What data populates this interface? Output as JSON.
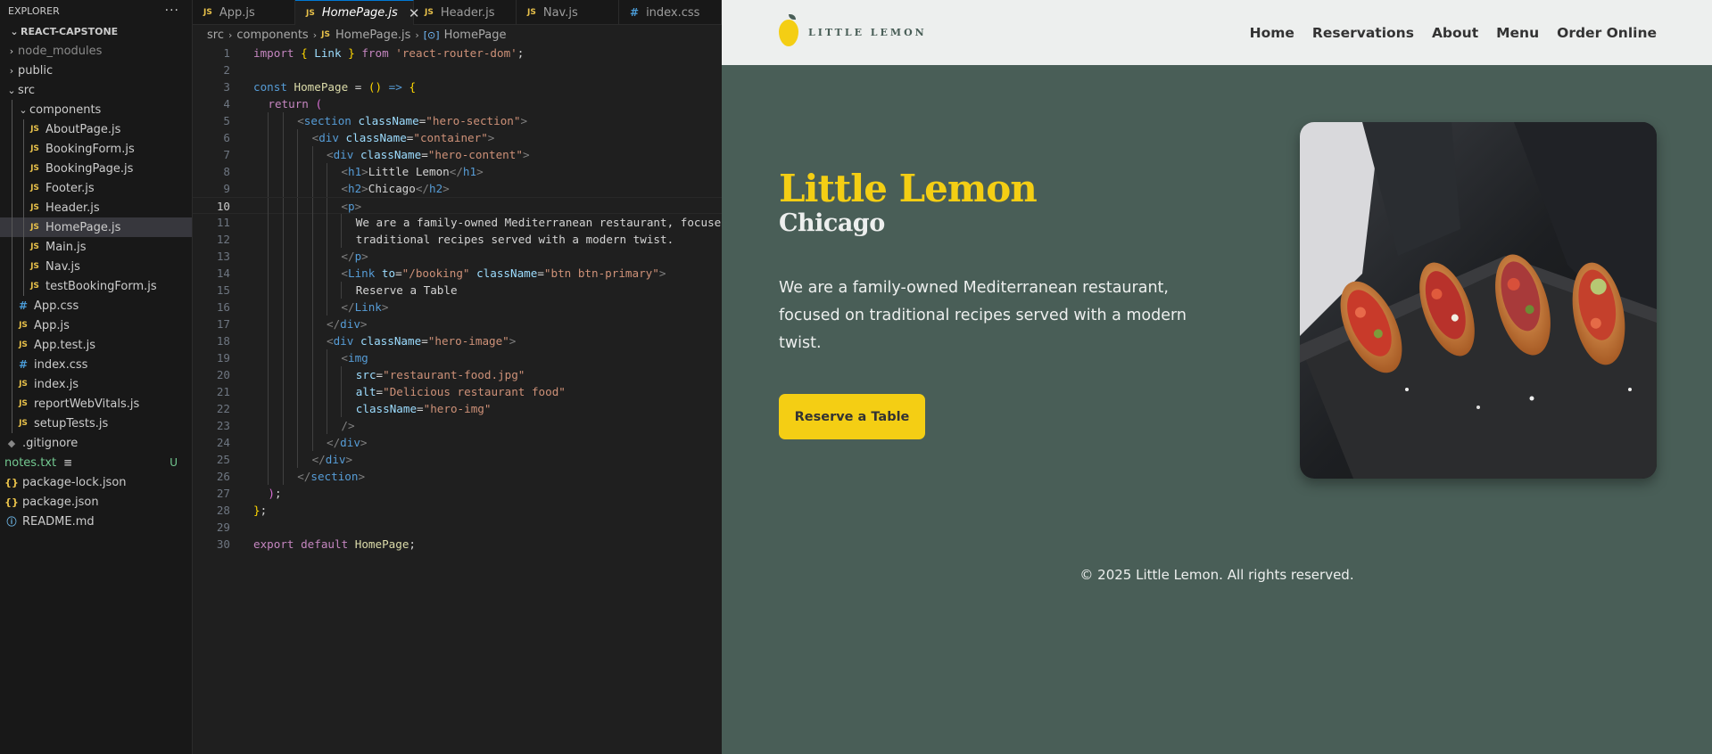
{
  "explorer": {
    "title": "EXPLORER",
    "more": "···",
    "project": "REACT-CAPSTONE",
    "items": [
      {
        "name": "node_modules",
        "type": "folder",
        "state": "closed",
        "depth": 0
      },
      {
        "name": "public",
        "type": "folder",
        "state": "closed",
        "depth": 0
      },
      {
        "name": "src",
        "type": "folder",
        "state": "open",
        "depth": 0
      },
      {
        "name": "components",
        "type": "folder",
        "state": "open",
        "depth": 1
      },
      {
        "name": "AboutPage.js",
        "type": "js",
        "depth": 2
      },
      {
        "name": "BookingForm.js",
        "type": "js",
        "depth": 2
      },
      {
        "name": "BookingPage.js",
        "type": "js",
        "depth": 2
      },
      {
        "name": "Footer.js",
        "type": "js",
        "depth": 2
      },
      {
        "name": "Header.js",
        "type": "js",
        "depth": 2
      },
      {
        "name": "HomePage.js",
        "type": "js",
        "depth": 2,
        "active": true
      },
      {
        "name": "Main.js",
        "type": "js",
        "depth": 2
      },
      {
        "name": "Nav.js",
        "type": "js",
        "depth": 2
      },
      {
        "name": "testBookingForm.js",
        "type": "js",
        "depth": 2
      },
      {
        "name": "App.css",
        "type": "css",
        "depth": 1
      },
      {
        "name": "App.js",
        "type": "js",
        "depth": 1
      },
      {
        "name": "App.test.js",
        "type": "js",
        "depth": 1
      },
      {
        "name": "index.css",
        "type": "css",
        "depth": 1
      },
      {
        "name": "index.js",
        "type": "js",
        "depth": 1
      },
      {
        "name": "reportWebVitals.js",
        "type": "js",
        "depth": 1
      },
      {
        "name": "setupTests.js",
        "type": "js",
        "depth": 1
      },
      {
        "name": ".gitignore",
        "type": "git",
        "depth": 0
      },
      {
        "name": "notes.txt",
        "type": "txt",
        "depth": 0,
        "badge": "U"
      },
      {
        "name": "package-lock.json",
        "type": "json",
        "depth": 0
      },
      {
        "name": "package.json",
        "type": "json",
        "depth": 0
      },
      {
        "name": "README.md",
        "type": "info",
        "depth": 0
      }
    ]
  },
  "editor": {
    "tabs": [
      {
        "label": "App.js",
        "type": "js"
      },
      {
        "label": "HomePage.js",
        "type": "js",
        "active": true
      },
      {
        "label": "Header.js",
        "type": "js"
      },
      {
        "label": "Nav.js",
        "type": "js"
      },
      {
        "label": "index.css",
        "type": "css"
      }
    ],
    "breadcrumb": [
      "src",
      "components",
      "HomePage.js",
      "HomePage"
    ],
    "current_line": 10,
    "lines": [
      {
        "n": "1",
        "indent": 0,
        "tokens": [
          [
            "import ",
            "k"
          ],
          [
            "{ ",
            "y"
          ],
          [
            "Link ",
            "v"
          ],
          [
            "} ",
            "y"
          ],
          [
            "from ",
            "k"
          ],
          [
            "'react-router-dom'",
            "s"
          ],
          [
            ";",
            "w"
          ]
        ]
      },
      {
        "n": "2",
        "indent": 0,
        "tokens": []
      },
      {
        "n": "3",
        "indent": 0,
        "tokens": [
          [
            "const ",
            "kb"
          ],
          [
            "HomePage ",
            "fn"
          ],
          [
            "= ",
            "w"
          ],
          [
            "()",
            "y"
          ],
          [
            " => ",
            "kb"
          ],
          [
            "{",
            "y"
          ]
        ]
      },
      {
        "n": "4",
        "indent": 1,
        "tokens": [
          [
            "return ",
            "k"
          ],
          [
            "(",
            "pk"
          ]
        ]
      },
      {
        "n": "5",
        "indent": 3,
        "tokens": [
          [
            "<",
            "p"
          ],
          [
            "section ",
            "t"
          ],
          [
            "className",
            "an"
          ],
          [
            "=",
            "w"
          ],
          [
            "\"hero-section\"",
            "s"
          ],
          [
            ">",
            "p"
          ]
        ]
      },
      {
        "n": "6",
        "indent": 4,
        "tokens": [
          [
            "<",
            "p"
          ],
          [
            "div ",
            "t"
          ],
          [
            "className",
            "an"
          ],
          [
            "=",
            "w"
          ],
          [
            "\"container\"",
            "s"
          ],
          [
            ">",
            "p"
          ]
        ]
      },
      {
        "n": "7",
        "indent": 5,
        "tokens": [
          [
            "<",
            "p"
          ],
          [
            "div ",
            "t"
          ],
          [
            "className",
            "an"
          ],
          [
            "=",
            "w"
          ],
          [
            "\"hero-content\"",
            "s"
          ],
          [
            ">",
            "p"
          ]
        ]
      },
      {
        "n": "8",
        "indent": 6,
        "tokens": [
          [
            "<",
            "p"
          ],
          [
            "h1",
            "t"
          ],
          [
            ">",
            "p"
          ],
          [
            "Little Lemon",
            "w"
          ],
          [
            "</",
            "p"
          ],
          [
            "h1",
            "t"
          ],
          [
            ">",
            "p"
          ]
        ]
      },
      {
        "n": "9",
        "indent": 6,
        "tokens": [
          [
            "<",
            "p"
          ],
          [
            "h2",
            "t"
          ],
          [
            ">",
            "p"
          ],
          [
            "Chicago",
            "w"
          ],
          [
            "</",
            "p"
          ],
          [
            "h2",
            "t"
          ],
          [
            ">",
            "p"
          ]
        ]
      },
      {
        "n": "10",
        "indent": 6,
        "tokens": [
          [
            "<",
            "p"
          ],
          [
            "p",
            "t"
          ],
          [
            ">",
            "p"
          ]
        ]
      },
      {
        "n": "11",
        "indent": 7,
        "tokens": [
          [
            "We are a family-owned Mediterranean restaurant, focused on",
            "w"
          ]
        ]
      },
      {
        "n": "12",
        "indent": 7,
        "tokens": [
          [
            "traditional recipes served with a modern twist.",
            "w"
          ]
        ]
      },
      {
        "n": "13",
        "indent": 6,
        "tokens": [
          [
            "</",
            "p"
          ],
          [
            "p",
            "t"
          ],
          [
            ">",
            "p"
          ]
        ]
      },
      {
        "n": "14",
        "indent": 6,
        "tokens": [
          [
            "<",
            "p"
          ],
          [
            "Link ",
            "t"
          ],
          [
            "to",
            "an"
          ],
          [
            "=",
            "w"
          ],
          [
            "\"/booking\" ",
            "s"
          ],
          [
            "className",
            "an"
          ],
          [
            "=",
            "w"
          ],
          [
            "\"btn btn-primary\"",
            "s"
          ],
          [
            ">",
            "p"
          ]
        ]
      },
      {
        "n": "15",
        "indent": 7,
        "tokens": [
          [
            "Reserve a Table",
            "w"
          ]
        ]
      },
      {
        "n": "16",
        "indent": 6,
        "tokens": [
          [
            "</",
            "p"
          ],
          [
            "Link",
            "t"
          ],
          [
            ">",
            "p"
          ]
        ]
      },
      {
        "n": "17",
        "indent": 5,
        "tokens": [
          [
            "</",
            "p"
          ],
          [
            "div",
            "t"
          ],
          [
            ">",
            "p"
          ]
        ]
      },
      {
        "n": "18",
        "indent": 5,
        "tokens": [
          [
            "<",
            "p"
          ],
          [
            "div ",
            "t"
          ],
          [
            "className",
            "an"
          ],
          [
            "=",
            "w"
          ],
          [
            "\"hero-image\"",
            "s"
          ],
          [
            ">",
            "p"
          ]
        ]
      },
      {
        "n": "19",
        "indent": 6,
        "tokens": [
          [
            "<",
            "p"
          ],
          [
            "img",
            "t"
          ]
        ]
      },
      {
        "n": "20",
        "indent": 7,
        "tokens": [
          [
            "src",
            "an"
          ],
          [
            "=",
            "w"
          ],
          [
            "\"restaurant-food.jpg\"",
            "s"
          ]
        ]
      },
      {
        "n": "21",
        "indent": 7,
        "tokens": [
          [
            "alt",
            "an"
          ],
          [
            "=",
            "w"
          ],
          [
            "\"Delicious restaurant food\"",
            "s"
          ]
        ]
      },
      {
        "n": "22",
        "indent": 7,
        "tokens": [
          [
            "className",
            "an"
          ],
          [
            "=",
            "w"
          ],
          [
            "\"hero-img\"",
            "s"
          ]
        ]
      },
      {
        "n": "23",
        "indent": 6,
        "tokens": [
          [
            "/>",
            "p"
          ]
        ]
      },
      {
        "n": "24",
        "indent": 5,
        "tokens": [
          [
            "</",
            "p"
          ],
          [
            "div",
            "t"
          ],
          [
            ">",
            "p"
          ]
        ]
      },
      {
        "n": "25",
        "indent": 4,
        "tokens": [
          [
            "</",
            "p"
          ],
          [
            "div",
            "t"
          ],
          [
            ">",
            "p"
          ]
        ]
      },
      {
        "n": "26",
        "indent": 3,
        "tokens": [
          [
            "</",
            "p"
          ],
          [
            "section",
            "t"
          ],
          [
            ">",
            "p"
          ]
        ]
      },
      {
        "n": "27",
        "indent": 1,
        "tokens": [
          [
            ")",
            "pk"
          ],
          [
            ";",
            "w"
          ]
        ]
      },
      {
        "n": "28",
        "indent": 0,
        "tokens": [
          [
            "}",
            "y"
          ],
          [
            ";",
            "w"
          ]
        ]
      },
      {
        "n": "29",
        "indent": 0,
        "tokens": []
      },
      {
        "n": "30",
        "indent": 0,
        "tokens": [
          [
            "export ",
            "k"
          ],
          [
            "default ",
            "k"
          ],
          [
            "HomePage",
            "fn"
          ],
          [
            ";",
            "w"
          ]
        ]
      }
    ]
  },
  "site": {
    "logo_text": "LITTLE LEMON",
    "nav": [
      "Home",
      "Reservations",
      "About",
      "Menu",
      "Order Online"
    ],
    "hero": {
      "title": "Little Lemon",
      "subtitle": "Chicago",
      "description": "We are a family-owned Mediterranean restaurant, focused on traditional recipes served with a modern twist.",
      "button": "Reserve a Table"
    },
    "footer": "© 2025 Little Lemon. All rights reserved.",
    "colors": {
      "primary_green": "#495e57",
      "primary_yellow": "#f4ce14",
      "light": "#edefee"
    }
  }
}
